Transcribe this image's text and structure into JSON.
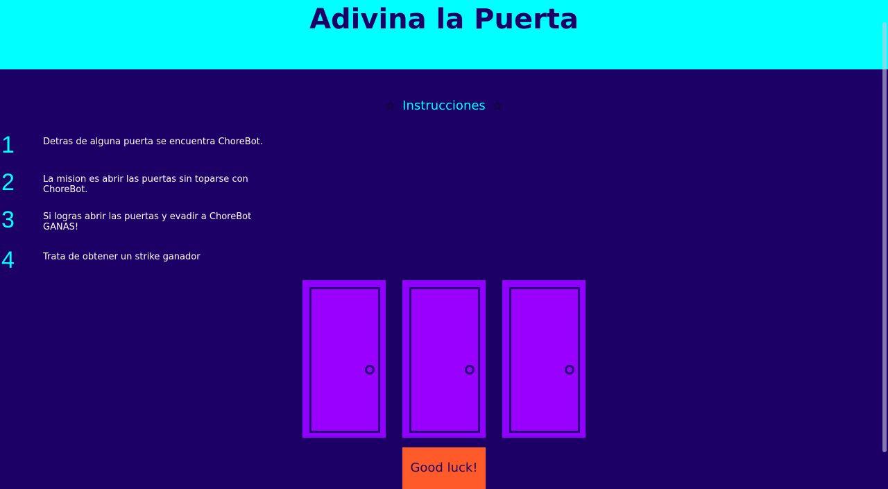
{
  "header": {
    "title": "Adivina la Puerta"
  },
  "instructions": {
    "heading": "Instrucciones",
    "star_icon": "☆",
    "steps": [
      {
        "number": "1",
        "text": "Detras de alguna puerta se encuentra ChoreBot."
      },
      {
        "number": "2",
        "text": "La mision es abrir las puertas sin toparse con ChoreBot."
      },
      {
        "number": "3",
        "text": "Si logras abrir las puertas y evadir a ChoreBot GANAS!"
      },
      {
        "number": "4",
        "text": "Trata de obtener un strike ganador"
      }
    ]
  },
  "doors": [
    {
      "icon": "closed-door-icon"
    },
    {
      "icon": "closed-door-icon"
    },
    {
      "icon": "closed-door-icon"
    }
  ],
  "start_button": {
    "label": "Good luck!"
  },
  "colors": {
    "background": "#1d0066",
    "header": "#00ffff",
    "accent": "#00ffff",
    "door": "#9000ff",
    "button": "#ff5a2a"
  }
}
